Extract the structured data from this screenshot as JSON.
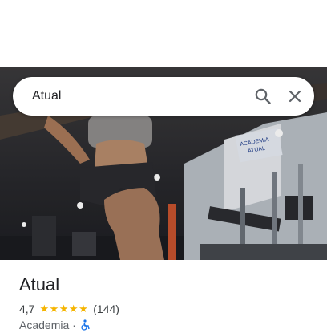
{
  "search": {
    "value": "Atual",
    "search_icon": "search-icon",
    "close_icon": "close-icon"
  },
  "hero": {
    "photo": "gym-interior-photo",
    "sign_line1": "ACADEMIA",
    "sign_line2": "ATUAL"
  },
  "place": {
    "title": "Atual",
    "rating": "4,7",
    "stars_glyph": "★★★★★",
    "review_count": "(144)",
    "category": "Academia ·",
    "accessibility_icon": "wheelchair-icon"
  },
  "colors": {
    "star": "#f5b400",
    "access": "#1a73e8",
    "text_primary": "#202124"
  }
}
